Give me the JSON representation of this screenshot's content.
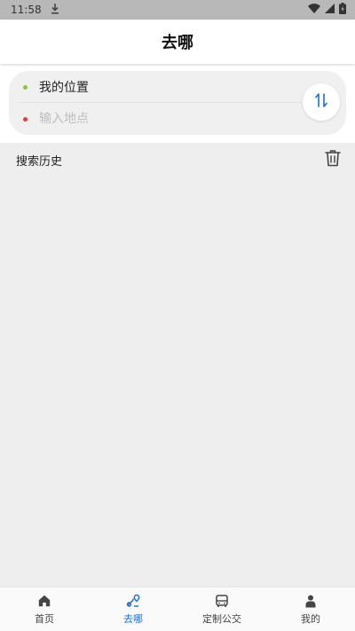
{
  "status_bar": {
    "time": "11:58"
  },
  "header": {
    "title": "去哪"
  },
  "route": {
    "from_label": "我的位置",
    "to_placeholder": "输入地点",
    "to_value": "",
    "from_dot_color": "#8bc34a",
    "to_dot_color": "#e53935"
  },
  "history": {
    "title": "搜索历史",
    "items": []
  },
  "bottom_nav": {
    "active_color": "#1a6fd0",
    "items": [
      {
        "label": "首页",
        "icon": "home-icon",
        "active": false
      },
      {
        "label": "去哪",
        "icon": "route-icon",
        "active": true
      },
      {
        "label": "定制公交",
        "icon": "bus-icon",
        "active": false
      },
      {
        "label": "我的",
        "icon": "person-icon",
        "active": false
      }
    ]
  }
}
